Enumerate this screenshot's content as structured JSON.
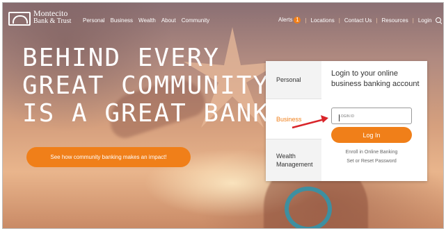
{
  "brand": {
    "name_line1": "Montecito",
    "name_line2": "Bank & Trust"
  },
  "nav": {
    "main": [
      "Personal",
      "Business",
      "Wealth",
      "About",
      "Community"
    ],
    "alerts_label": "Alerts",
    "alerts_count": "1",
    "utility": [
      "Locations",
      "Contact Us",
      "Resources",
      "Login"
    ],
    "separator": "|"
  },
  "hero": {
    "title_lines": [
      "BEHIND EVERY",
      "GREAT COMMUNITY",
      "IS A GREAT BANK"
    ],
    "cta_label": "See how community banking makes an impact!"
  },
  "login_card": {
    "tabs": [
      "Personal",
      "Business",
      "Wealth Management"
    ],
    "active_tab": "Business",
    "title": "Login to your online business banking account",
    "input_placeholder": "LOGIN ID",
    "button_label": "Log In",
    "links": [
      "Enroll in Online Banking",
      "Set or Reset Password"
    ]
  },
  "colors": {
    "accent": "#f07f19",
    "annotation_arrow": "#d9252a"
  },
  "icons": [
    "logo-mark-icon",
    "search-icon",
    "arrow-annotation-icon"
  ]
}
